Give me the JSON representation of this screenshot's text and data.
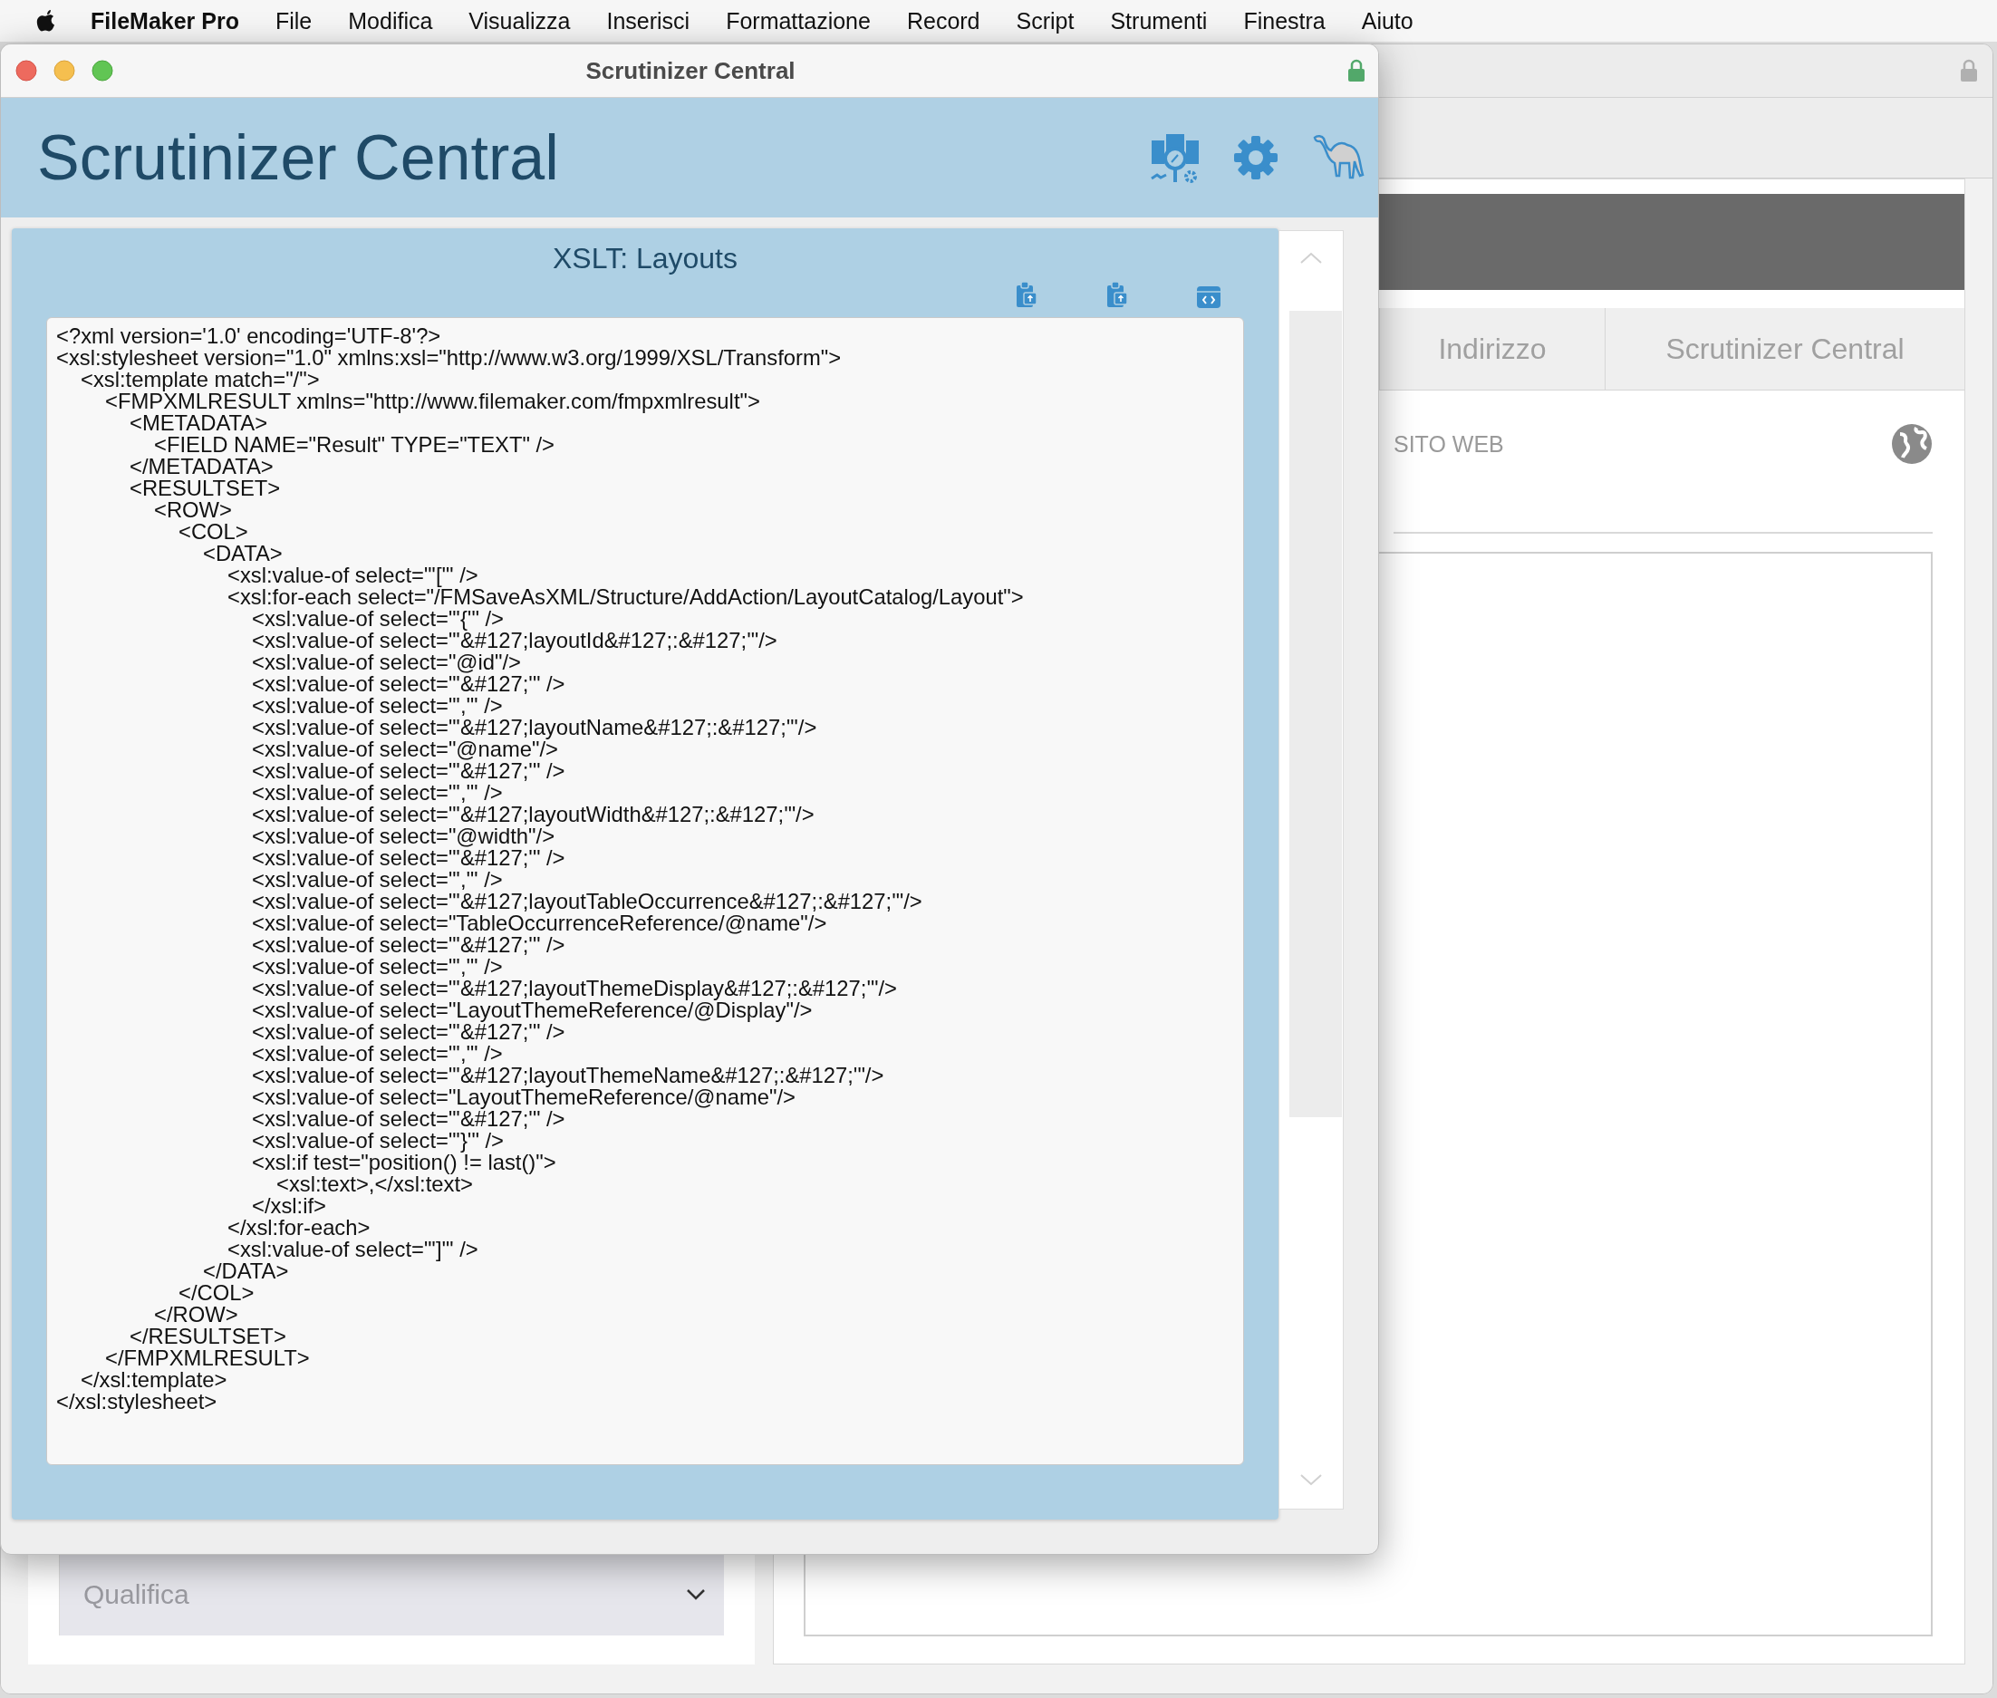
{
  "menu_bar": {
    "app_name": "FileMaker Pro",
    "items": [
      "File",
      "Modifica",
      "Visualizza",
      "Inserisci",
      "Formattazione",
      "Record",
      "Script",
      "Strumenti",
      "Finestra",
      "Aiuto"
    ]
  },
  "back_window": {
    "tabs": [
      {
        "label": "Indirizzo",
        "selected": false
      },
      {
        "label": "Scrutinizer Central",
        "selected": false
      }
    ],
    "field_label": "SITO WEB",
    "dropdown": {
      "placeholder": "Qualifica"
    }
  },
  "window": {
    "title": "Scrutinizer Central",
    "header_title": "Scrutinizer Central",
    "panel": {
      "title": "XSLT: Layouts",
      "code": [
        {
          "text": "<?xml version='1.0' encoding='UTF-8'?>"
        },
        {
          "text": "<xsl:stylesheet version=\"1.0\" xmlns:xsl=\"http://www.w3.org/1999/XSL/Transform\">",
          "children": [
            {
              "text": "<xsl:template match=\"/\">",
              "children": [
                {
                  "text": "<FMPXMLRESULT xmlns=\"http://www.filemaker.com/fmpxmlresult\">",
                  "children": [
                    {
                      "text": "<METADATA>",
                      "children": [
                        {
                          "text": "<FIELD NAME=\"Result\" TYPE=\"TEXT\" />"
                        }
                      ]
                    },
                    {
                      "text": "</METADATA>"
                    },
                    {
                      "text": "<RESULTSET>",
                      "children": [
                        {
                          "text": "<ROW>",
                          "children": [
                            {
                              "text": "<COL>",
                              "children": [
                                {
                                  "text": "<DATA>",
                                  "children": [
                                    {
                                      "text": "<xsl:value-of select=\"'['\" />"
                                    },
                                    {
                                      "text": "<xsl:for-each select=\"/FMSaveAsXML/Structure/AddAction/LayoutCatalog/Layout\">",
                                      "children": [
                                        {
                                          "text": "<xsl:value-of select=\"'{'\" />"
                                        },
                                        {
                                          "text": "<xsl:value-of select=\"'&#127;layoutId&#127;:&#127;'\"/>"
                                        },
                                        {
                                          "text": "<xsl:value-of select=\"@id\"/>"
                                        },
                                        {
                                          "text": "<xsl:value-of select=\"'&#127;'\" />"
                                        },
                                        {
                                          "text": "<xsl:value-of select=\"','\" />"
                                        },
                                        {
                                          "text": "<xsl:value-of select=\"'&#127;layoutName&#127;:&#127;'\"/>"
                                        },
                                        {
                                          "text": "<xsl:value-of select=\"@name\"/>"
                                        },
                                        {
                                          "text": "<xsl:value-of select=\"'&#127;'\" />"
                                        },
                                        {
                                          "text": "<xsl:value-of select=\"','\" />"
                                        },
                                        {
                                          "text": "<xsl:value-of select=\"'&#127;layoutWidth&#127;:&#127;'\"/>"
                                        },
                                        {
                                          "text": "<xsl:value-of select=\"@width\"/>"
                                        },
                                        {
                                          "text": "<xsl:value-of select=\"'&#127;'\" />"
                                        },
                                        {
                                          "text": "<xsl:value-of select=\"','\" />"
                                        },
                                        {
                                          "text": "<xsl:value-of select=\"'&#127;layoutTableOccurrence&#127;:&#127;'\"/>"
                                        },
                                        {
                                          "text": "<xsl:value-of select=\"TableOccurrenceReference/@name\"/>"
                                        },
                                        {
                                          "text": "<xsl:value-of select=\"'&#127;'\" />"
                                        },
                                        {
                                          "text": "<xsl:value-of select=\"','\" />"
                                        },
                                        {
                                          "text": "<xsl:value-of select=\"'&#127;layoutThemeDisplay&#127;:&#127;'\"/>"
                                        },
                                        {
                                          "text": "<xsl:value-of select=\"LayoutThemeReference/@Display\"/>"
                                        },
                                        {
                                          "text": "<xsl:value-of select=\"'&#127;'\" />"
                                        },
                                        {
                                          "text": "<xsl:value-of select=\"','\" />"
                                        },
                                        {
                                          "text": "<xsl:value-of select=\"'&#127;layoutThemeName&#127;:&#127;'\"/>"
                                        },
                                        {
                                          "text": "<xsl:value-of select=\"LayoutThemeReference/@name\"/>"
                                        },
                                        {
                                          "text": "<xsl:value-of select=\"'&#127;'\" />"
                                        },
                                        {
                                          "text": "<xsl:value-of select=\"'}'\" />"
                                        },
                                        {
                                          "text": "<xsl:if test=\"position() != last()\">",
                                          "children": [
                                            {
                                              "text": "<xsl:text>,</xsl:text>"
                                            }
                                          ]
                                        },
                                        {
                                          "text": "</xsl:if>"
                                        }
                                      ]
                                    },
                                    {
                                      "text": "</xsl:for-each>"
                                    },
                                    {
                                      "text": "<xsl:value-of select=\"']'\" />"
                                    }
                                  ]
                                },
                                {
                                  "text": "</DATA>"
                                }
                              ]
                            },
                            {
                              "text": "</COL>"
                            }
                          ]
                        },
                        {
                          "text": "</ROW>"
                        }
                      ]
                    },
                    {
                      "text": "</RESULTSET>"
                    }
                  ]
                },
                {
                  "text": "</FMPXMLRESULT>"
                }
              ]
            },
            {
              "text": "</xsl:template>"
            }
          ]
        },
        {
          "text": "</xsl:stylesheet>"
        }
      ]
    }
  }
}
